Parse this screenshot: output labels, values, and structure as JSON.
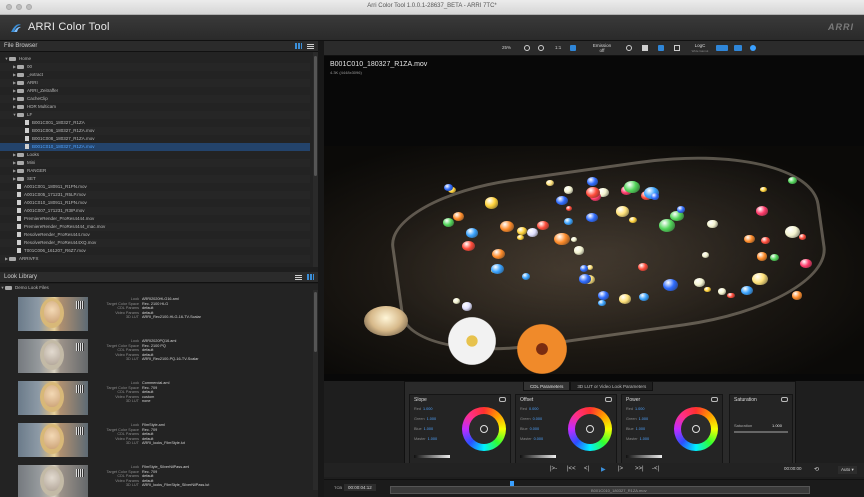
{
  "window": {
    "title": "Arri Color Tool 1.0.0.1-28637_BETA - ARRI 7TC*"
  },
  "app": {
    "name": "ARRI Color Tool",
    "brand": "ARRI"
  },
  "file_browser": {
    "title": "File Browser",
    "items": [
      {
        "label": "Home",
        "type": "folder",
        "depth": 0,
        "expanded": true
      },
      {
        "label": "00",
        "type": "folder",
        "depth": 1,
        "expanded": false
      },
      {
        "label": "_extract",
        "type": "folder",
        "depth": 1,
        "expanded": false
      },
      {
        "label": "ARRI",
        "type": "folder",
        "depth": 1,
        "expanded": false
      },
      {
        "label": "ARRI_Zeitraffer",
        "type": "folder",
        "depth": 1,
        "expanded": false
      },
      {
        "label": "CacheClip",
        "type": "folder",
        "depth": 1,
        "expanded": false
      },
      {
        "label": "HDR Multicam",
        "type": "folder",
        "depth": 1,
        "expanded": false
      },
      {
        "label": "LF",
        "type": "folder",
        "depth": 1,
        "expanded": true
      },
      {
        "label": "B001C001_180327_R1ZA",
        "type": "file",
        "depth": 2
      },
      {
        "label": "B001C006_180327_R1ZA.mov",
        "type": "file",
        "depth": 2
      },
      {
        "label": "B001C008_180327_R1ZA.mov",
        "type": "file",
        "depth": 2
      },
      {
        "label": "B001C010_180327_R1ZA.mov",
        "type": "file",
        "depth": 2,
        "selected": true
      },
      {
        "label": "Looks",
        "type": "folder",
        "depth": 1,
        "expanded": false
      },
      {
        "label": "Mini",
        "type": "folder",
        "depth": 1,
        "expanded": false
      },
      {
        "label": "RANGER",
        "type": "folder",
        "depth": 1,
        "expanded": false
      },
      {
        "label": "SET",
        "type": "folder",
        "depth": 1,
        "expanded": false
      },
      {
        "label": "A001C001_180911_R1PN.mov",
        "type": "file",
        "depth": 1
      },
      {
        "label": "A001C005_171231_R5LP.mov",
        "type": "file",
        "depth": 1
      },
      {
        "label": "A001C010_180911_R1PN.mov",
        "type": "file",
        "depth": 1
      },
      {
        "label": "A001C007_171231_R3IP.mov",
        "type": "file",
        "depth": 1
      },
      {
        "label": "PremiereRender_ProRes4444.mov",
        "type": "file",
        "depth": 1
      },
      {
        "label": "PremiereRender_ProRes4444_mac.mov",
        "type": "file",
        "depth": 1
      },
      {
        "label": "ResolveRender_ProRes444.mov",
        "type": "file",
        "depth": 1
      },
      {
        "label": "ResolveRender_ProRes444XQ.mov",
        "type": "file",
        "depth": 1
      },
      {
        "label": "T001C006_161207_R6Z7.mov",
        "type": "file",
        "depth": 1
      },
      {
        "label": "ARRIVFX",
        "type": "folder",
        "depth": 0,
        "expanded": false
      }
    ]
  },
  "look_library": {
    "title": "Look Library",
    "group": "Demo Look Files",
    "field_labels": {
      "look": "Look",
      "target": "Target Color Space",
      "cdl": "CDL Params",
      "video": "Video Params",
      "lut": "3D LUT"
    },
    "looks": [
      {
        "look": "ARRI2020HLG16.aml",
        "target": "Rec. 2100 HLG",
        "cdl": "default",
        "video": "default",
        "lut": "ARRI_Rec2100-HLG-16-TV-Scalar",
        "bw": false
      },
      {
        "look": "ARRI2020PQ16.aml",
        "target": "Rec. 2100 PQ",
        "cdl": "default",
        "video": "default",
        "lut": "ARRI_Rec2100-PQ-16-TV-Scalar",
        "bw": true
      },
      {
        "look": "Commercial.aml",
        "target": "Rec. 709",
        "cdl": "default",
        "video": "custom",
        "lut": "none",
        "bw": false
      },
      {
        "look": "FilmStyle.aml",
        "target": "Rec. 709",
        "cdl": "default",
        "video": "default",
        "lut": "ARRI_looks_FilmStyle.lut",
        "bw": false
      },
      {
        "look": "FilmStyle_SilverNilPass.aml",
        "target": "Rec. 709",
        "cdl": "default",
        "video": "default",
        "lut": "ARRI_looks_FilmStyle_SilverNilPass.lut",
        "bw": true
      }
    ]
  },
  "toolbar": {
    "zoom": "25%",
    "fit": "1:1",
    "emission": "Emission\noff",
    "logc": "LogC",
    "logc_sub": "Wide Gamut"
  },
  "viewer": {
    "filename": "B001C010_180327_R1ZA.mov",
    "subinfo": "4.3K (4448x3096)"
  },
  "grading": {
    "tabs": [
      "CDL Parameters",
      "3D LUT or Video Look Parameters"
    ],
    "active_tab": 0,
    "panels": [
      {
        "title": "Slope",
        "params": [
          {
            "k": "Red",
            "v": "1.000"
          },
          {
            "k": "Green",
            "v": "1.000"
          },
          {
            "k": "Blue",
            "v": "1.000"
          },
          {
            "k": "Master",
            "v": "1.000"
          }
        ]
      },
      {
        "title": "Offset",
        "params": [
          {
            "k": "Red",
            "v": "0.000"
          },
          {
            "k": "Green",
            "v": "0.000"
          },
          {
            "k": "Blue",
            "v": "0.000"
          },
          {
            "k": "Master",
            "v": "0.000"
          }
        ]
      },
      {
        "title": "Power",
        "params": [
          {
            "k": "Red",
            "v": "1.000"
          },
          {
            "k": "Green",
            "v": "1.000"
          },
          {
            "k": "Blue",
            "v": "1.000"
          },
          {
            "k": "Master",
            "v": "1.000"
          }
        ]
      }
    ],
    "saturation": {
      "title": "Saturation",
      "label": "Saturation",
      "value": "1.000"
    }
  },
  "transport": {
    "buttons": [
      "|>-",
      "|<<",
      "<|",
      "▶",
      "|>",
      ">>|",
      "-<|"
    ],
    "timecode_right": "00:00:00"
  },
  "timeline": {
    "label": "TCB",
    "timecode": "00:00:04:12",
    "clip_name": "B001C010_180327_R1ZA.mov"
  }
}
